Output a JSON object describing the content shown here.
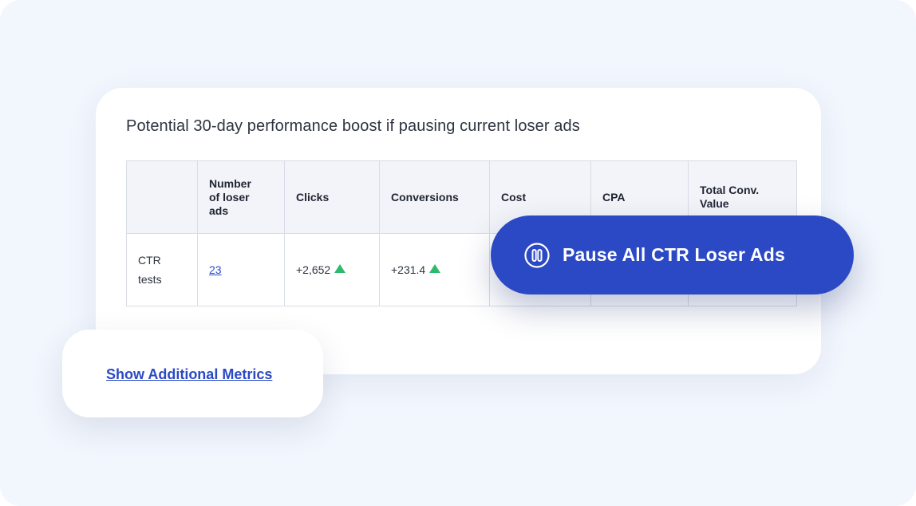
{
  "card": {
    "title": "Potential 30-day performance boost if pausing current loser ads"
  },
  "table": {
    "headers": [
      "",
      "Number of loser ads",
      "Clicks",
      "Conversions",
      "Cost",
      "CPA",
      "Total Conv. Value"
    ],
    "rows": [
      {
        "label": "CTR tests",
        "loser_ads": "23",
        "clicks": "+2,652",
        "clicks_trend": "up",
        "conversions": "+231.4",
        "conversions_trend": "up",
        "cost": "",
        "cpa": "",
        "total_conv_value": ""
      }
    ],
    "trend_color": "#2dbb6b",
    "link_color": "#2b4bd0"
  },
  "pause_button": {
    "label": "Pause All CTR Loser Ads",
    "icon": "pause-circle-icon",
    "color": "#2b49c5"
  },
  "metrics_link": {
    "label": "Show Additional Metrics"
  }
}
